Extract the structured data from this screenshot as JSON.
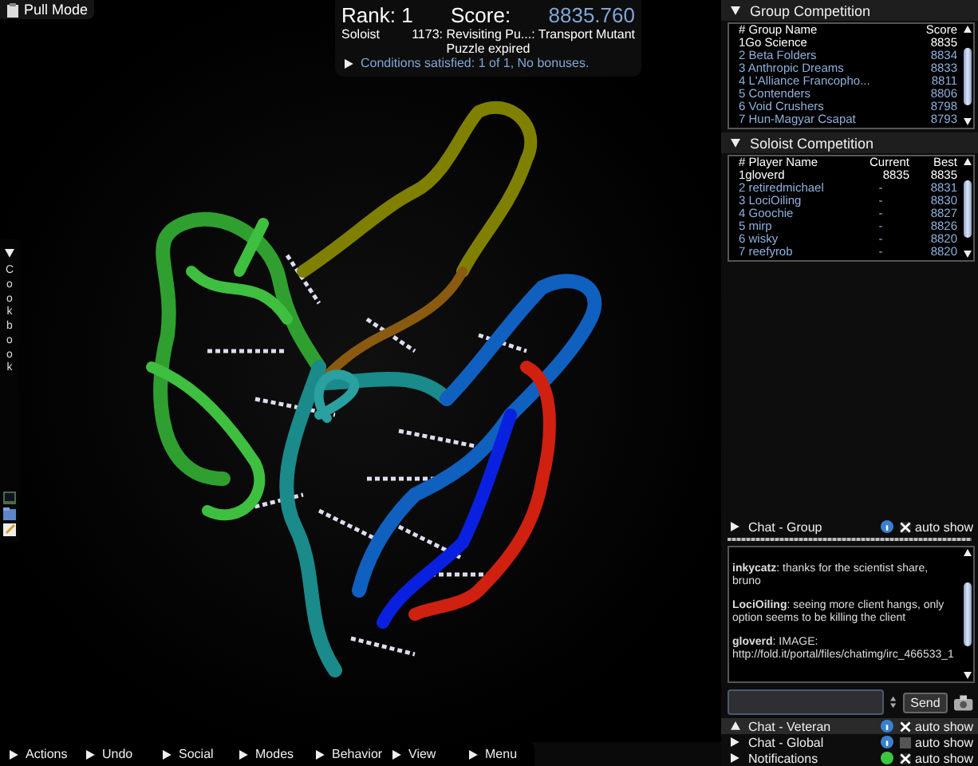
{
  "mode_label": "Pull Mode",
  "score_panel": {
    "rank": "Rank: 1",
    "score_label": "Score:",
    "score": "8835.760",
    "role": "Soloist",
    "puzzle": "1173: Revisiting Pu...: Transport Mutant",
    "status": "Puzzle expired",
    "conditions": "Conditions satisfied: 1 of 1, No bonuses.",
    "conditions_expanded": false
  },
  "cookbook": {
    "title": "Cookbook",
    "expanded": true
  },
  "group_competition": {
    "title": "Group Competition",
    "expanded": true,
    "columns": [
      "# Group Name",
      "Score"
    ],
    "rows": [
      {
        "rank": "1",
        "name": "Go Science",
        "score": "8835",
        "selected": true
      },
      {
        "rank": "2",
        "name": "Beta Folders",
        "score": "8834",
        "selected": false
      },
      {
        "rank": "3",
        "name": "Anthropic Dreams",
        "score": "8833",
        "selected": false
      },
      {
        "rank": "4",
        "name": "L'Alliance Francopho...",
        "score": "8811",
        "selected": false
      },
      {
        "rank": "5",
        "name": "Contenders",
        "score": "8806",
        "selected": false
      },
      {
        "rank": "6",
        "name": "Void Crushers",
        "score": "8798",
        "selected": false
      },
      {
        "rank": "7",
        "name": "Hun-Magyar Csapat",
        "score": "8793",
        "selected": false
      }
    ]
  },
  "soloist_competition": {
    "title": "Soloist Competition",
    "expanded": true,
    "columns": [
      "# Player Name",
      "Current",
      "Best"
    ],
    "rows": [
      {
        "rank": "1",
        "name": "gloverd",
        "current": "8835",
        "best": "8835",
        "selected": true
      },
      {
        "rank": "2",
        "name": "retiredmichael",
        "current": "-",
        "best": "8831",
        "selected": false
      },
      {
        "rank": "3",
        "name": "LociOiling",
        "current": "-",
        "best": "8830",
        "selected": false
      },
      {
        "rank": "4",
        "name": "Goochie",
        "current": "-",
        "best": "8827",
        "selected": false
      },
      {
        "rank": "5",
        "name": "mirp",
        "current": "-",
        "best": "8826",
        "selected": false
      },
      {
        "rank": "6",
        "name": "wisky",
        "current": "-",
        "best": "8820",
        "selected": false
      },
      {
        "rank": "7",
        "name": "reefyrob",
        "current": "-",
        "best": "8820",
        "selected": false
      }
    ]
  },
  "chat_group": {
    "title": "Chat - Group",
    "expanded": false,
    "auto_show": true,
    "auto_show_label": "auto show",
    "kind": "info"
  },
  "chat_messages": [
    {
      "text": "**inkycatz**: thanks for the scientist share, bruno"
    },
    {
      "text": "**LociOiling**: seeing more client hangs, only option seems to be killing the client"
    },
    {
      "text": "**gloverd**: IMAGE: http://fold.it/portal/files/chatimg/irc_466533_1"
    }
  ],
  "chat_input": {
    "send_label": "Send"
  },
  "chat_sections": [
    {
      "title": "Chat - Veteran",
      "expanded": true,
      "selected": true,
      "auto_show": true,
      "auto_show_label": "auto show",
      "kind": "info"
    },
    {
      "title": "Chat - Global",
      "expanded": false,
      "selected": false,
      "auto_show": false,
      "auto_show_label": "auto show",
      "kind": "info"
    },
    {
      "title": "Notifications",
      "expanded": false,
      "selected": false,
      "auto_show": true,
      "auto_show_label": "auto show",
      "kind": "online"
    }
  ],
  "bottom_menu": [
    {
      "label": "Actions"
    },
    {
      "label": "Undo"
    },
    {
      "label": "Social"
    },
    {
      "label": "Modes"
    },
    {
      "label": "Behavior"
    },
    {
      "label": "View"
    },
    {
      "label": "Menu"
    }
  ]
}
